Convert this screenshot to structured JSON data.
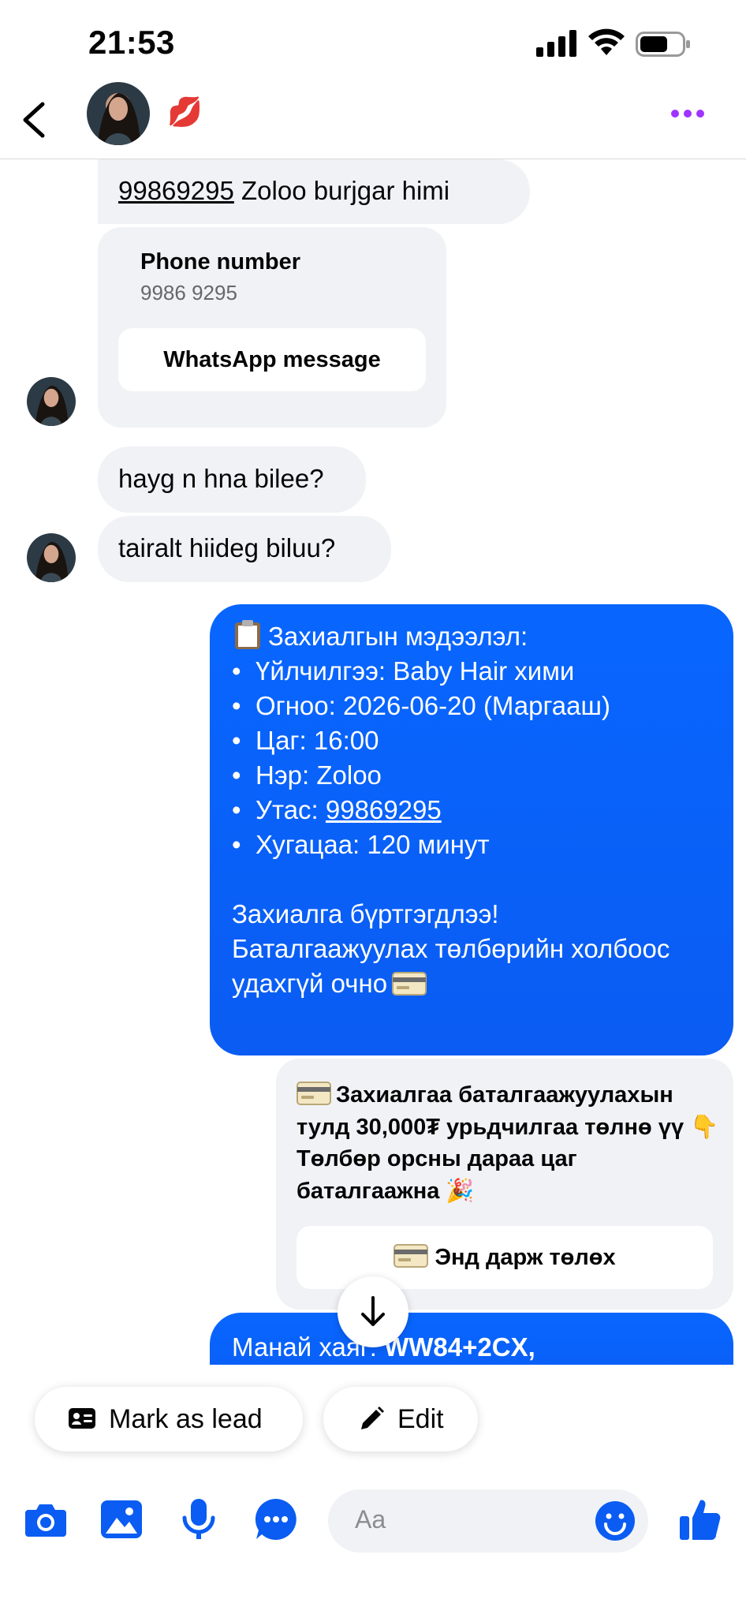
{
  "status_bar": {
    "time": "21:53"
  },
  "header": {
    "contact_emoji": "💋"
  },
  "messages": {
    "m1": {
      "phone": "99869295",
      "rest": " Zoloo burjgar himi"
    },
    "contact_card": {
      "title": "Phone number",
      "number": "9986 9295",
      "button": "WhatsApp message"
    },
    "m2": "hayg n hna bilee?",
    "m3": "tairalt hiideg biluu?",
    "booking": {
      "title": "Захиалгын мэдээлэл:",
      "items": [
        "Үйлчилгээ: Baby Hair хими",
        "Огноо: 2026-06-20 (Маргааш)",
        "Цаг: 16:00",
        "Нэр: Zoloo"
      ],
      "phone_label": "Утас: ",
      "phone_value": "99869295",
      "duration": "Хугацаа: 120 минут",
      "footer_1": "Захиалга бүртгэгдлээ!",
      "footer_2": "Баталгаажуулах төлбөрийн холбоос",
      "footer_3": "удахгүй очно"
    },
    "payment_card": {
      "text": "Захиалгаа баталгаажуулахын тулд 30,000₮ урьдчилгаа төлнө үү",
      "text_2": "Төлбөр орсны дараа цаг баталгаажна",
      "pointing_emoji": "👇",
      "party_emoji": "🎉",
      "button": "Энд дарж төлөх"
    },
    "address": {
      "label": "Манай хаяг: ",
      "value": "WW84+2CX,"
    }
  },
  "actions": {
    "mark_lead": "Mark as lead",
    "edit": "Edit"
  },
  "composer": {
    "placeholder": "Aa"
  },
  "colors": {
    "accent": "#0866ff",
    "bubble_incoming": "#f0f2f5",
    "icon": "#0a5cf2",
    "more_dots": "#a033ff"
  }
}
